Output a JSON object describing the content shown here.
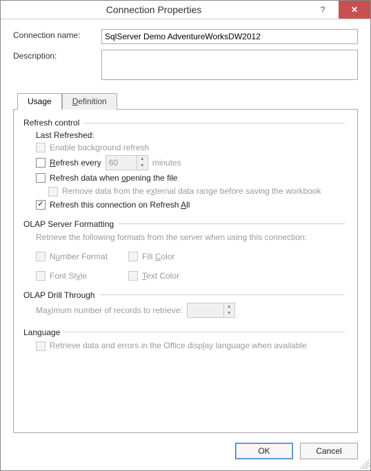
{
  "window": {
    "title": "Connection Properties",
    "help_glyph": "?",
    "close_glyph": "✕"
  },
  "fields": {
    "connection_name_label": "Connection name:",
    "connection_name_value": "SqlServer Demo AdventureWorksDW2012",
    "description_label": "Description:",
    "description_value": ""
  },
  "tabs": {
    "usage": "Usage",
    "definition": "Definition"
  },
  "refresh": {
    "group": "Refresh control",
    "last_refreshed": "Last Refreshed:",
    "enable_background": "Enable background refresh",
    "refresh_every_pre": "Refresh every",
    "refresh_every_value": "60",
    "refresh_every_unit": "minutes",
    "refresh_on_open": "Refresh data when opening the file",
    "remove_data": "Remove data from the external data range before saving the workbook",
    "refresh_all": "Refresh this connection on Refresh All"
  },
  "olap_fmt": {
    "group": "OLAP Server Formatting",
    "subtext": "Retrieve the following formats from the server when using this connection:",
    "number_format": "Number Format",
    "fill_color": "Fill Color",
    "font_style": "Font Style",
    "text_color": "Text Color"
  },
  "olap_drill": {
    "group": "OLAP Drill Through",
    "max_records": "Maximum number of records to retrieve:",
    "max_records_value": ""
  },
  "language": {
    "group": "Language",
    "retrieve": "Retrieve data and errors in the Office display language when available"
  },
  "buttons": {
    "ok": "OK",
    "cancel": "Cancel"
  }
}
